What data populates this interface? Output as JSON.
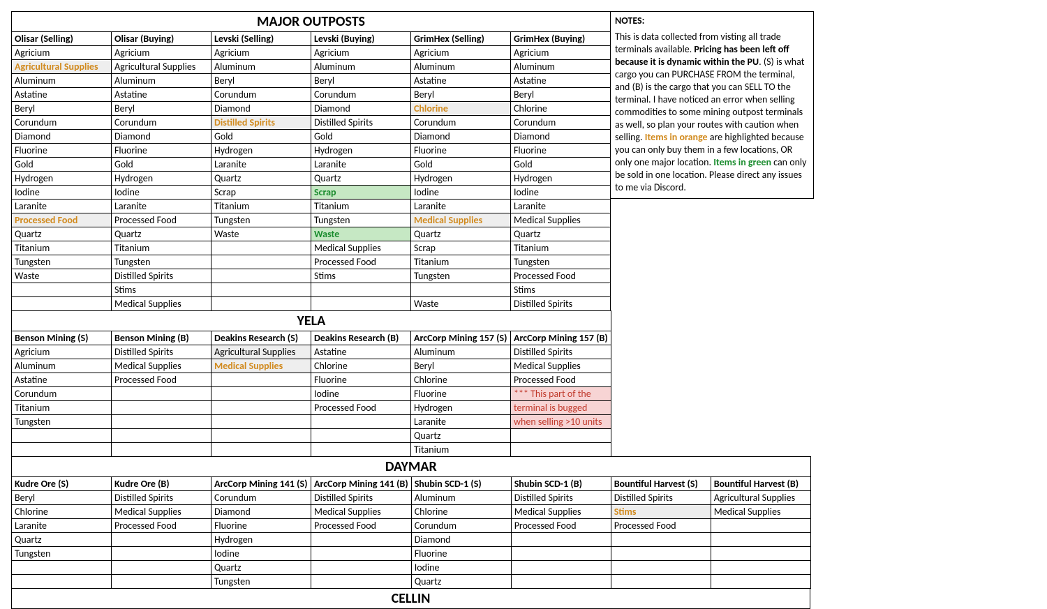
{
  "titles": {
    "major": "MAJOR OUTPOSTS",
    "yela": "YELA",
    "daymar": "DAYMAR",
    "cellin": "CELLIN"
  },
  "notes": {
    "heading": "NOTES:",
    "t0": "This is data collected from visting all trade terminals available.  ",
    "t1": "Pricing has been left off because it is dynamic within the PU",
    "t2": ".  (S) is what cargo you can PURCHASE FROM the terminal, and (B) is the cargo that you can SELL TO the terminal.  I have noticed an error when selling commodities to some mining outpost terminals as well, so plan your routes with caution when selling. ",
    "t3": "Items in orange",
    "t4": " are highlighted because you can only buy them in a few locations, OR only one major location.  ",
    "t5": "Items in green",
    "t6": " can only be sold in one location.  Please direct any issues to me via Discord."
  },
  "major": {
    "headers": [
      "Olisar (Selling)",
      "Olisar (Buying)",
      "Levski (Selling)",
      "Levski (Buying)",
      "GrimHex (Selling)",
      "GrimHex (Buying)"
    ],
    "rows": [
      [
        {
          "v": "Agricium"
        },
        {
          "v": "Agricium"
        },
        {
          "v": "Agricium"
        },
        {
          "v": "Agricium"
        },
        {
          "v": "Agricium"
        },
        {
          "v": "Agricium"
        }
      ],
      [
        {
          "v": "Agricultural Supplies",
          "c": "orange",
          "bg": "grey"
        },
        {
          "v": "Agricultural Supplies"
        },
        {
          "v": "Aluminum"
        },
        {
          "v": "Aluminum"
        },
        {
          "v": "Aluminum"
        },
        {
          "v": "Aluminum"
        }
      ],
      [
        {
          "v": "Aluminum"
        },
        {
          "v": "Aluminum"
        },
        {
          "v": "Beryl"
        },
        {
          "v": "Beryl"
        },
        {
          "v": "Astatine"
        },
        {
          "v": "Astatine"
        }
      ],
      [
        {
          "v": "Astatine"
        },
        {
          "v": "Astatine"
        },
        {
          "v": "Corundum"
        },
        {
          "v": "Corundum"
        },
        {
          "v": "Beryl"
        },
        {
          "v": "Beryl"
        }
      ],
      [
        {
          "v": "Beryl"
        },
        {
          "v": "Beryl"
        },
        {
          "v": "Diamond"
        },
        {
          "v": "Diamond"
        },
        {
          "v": "Chlorine",
          "c": "orange",
          "bg": "grey"
        },
        {
          "v": "Chlorine"
        }
      ],
      [
        {
          "v": "Corundum"
        },
        {
          "v": "Corundum"
        },
        {
          "v": "Distilled Spirits",
          "c": "orange",
          "bg": "grey"
        },
        {
          "v": "Distilled Spirits"
        },
        {
          "v": "Corundum"
        },
        {
          "v": "Corundum"
        }
      ],
      [
        {
          "v": "Diamond"
        },
        {
          "v": "Diamond"
        },
        {
          "v": "Gold"
        },
        {
          "v": "Gold"
        },
        {
          "v": "Diamond"
        },
        {
          "v": "Diamond"
        }
      ],
      [
        {
          "v": "Fluorine"
        },
        {
          "v": "Fluorine"
        },
        {
          "v": "Hydrogen"
        },
        {
          "v": "Hydrogen"
        },
        {
          "v": "Fluorine"
        },
        {
          "v": "Fluorine"
        }
      ],
      [
        {
          "v": "Gold"
        },
        {
          "v": "Gold"
        },
        {
          "v": "Laranite"
        },
        {
          "v": "Laranite"
        },
        {
          "v": "Gold"
        },
        {
          "v": "Gold"
        }
      ],
      [
        {
          "v": "Hydrogen"
        },
        {
          "v": "Hydrogen"
        },
        {
          "v": "Quartz"
        },
        {
          "v": "Quartz"
        },
        {
          "v": "Hydrogen"
        },
        {
          "v": "Hydrogen"
        }
      ],
      [
        {
          "v": "Iodine"
        },
        {
          "v": "Iodine"
        },
        {
          "v": "Scrap"
        },
        {
          "v": "Scrap",
          "c": "green",
          "bg": "green"
        },
        {
          "v": "Iodine"
        },
        {
          "v": "Iodine"
        }
      ],
      [
        {
          "v": "Laranite"
        },
        {
          "v": "Laranite"
        },
        {
          "v": "Titanium"
        },
        {
          "v": "Titanium"
        },
        {
          "v": "Laranite"
        },
        {
          "v": "Laranite"
        }
      ],
      [
        {
          "v": "Processed Food",
          "c": "orange",
          "bg": "grey"
        },
        {
          "v": "Processed Food"
        },
        {
          "v": "Tungsten"
        },
        {
          "v": "Tungsten"
        },
        {
          "v": "Medical Supplies",
          "c": "orange",
          "bg": "grey"
        },
        {
          "v": "Medical Supplies"
        }
      ],
      [
        {
          "v": "Quartz"
        },
        {
          "v": "Quartz"
        },
        {
          "v": "Waste"
        },
        {
          "v": "Waste",
          "c": "green",
          "bg": "green"
        },
        {
          "v": "Quartz"
        },
        {
          "v": "Quartz"
        }
      ],
      [
        {
          "v": "Titanium"
        },
        {
          "v": "Titanium"
        },
        {
          "v": ""
        },
        {
          "v": "Medical Supplies"
        },
        {
          "v": "Scrap"
        },
        {
          "v": "Titanium"
        }
      ],
      [
        {
          "v": "Tungsten"
        },
        {
          "v": "Tungsten"
        },
        {
          "v": ""
        },
        {
          "v": "Processed Food"
        },
        {
          "v": "Titanium"
        },
        {
          "v": "Tungsten"
        }
      ],
      [
        {
          "v": "Waste"
        },
        {
          "v": "Distilled Spirits"
        },
        {
          "v": ""
        },
        {
          "v": "Stims"
        },
        {
          "v": "Tungsten"
        },
        {
          "v": "Processed Food"
        }
      ],
      [
        {
          "v": ""
        },
        {
          "v": "Stims"
        },
        {
          "v": ""
        },
        {
          "v": ""
        },
        {
          "v": ""
        },
        {
          "v": "Stims"
        }
      ],
      [
        {
          "v": ""
        },
        {
          "v": "Medical Supplies"
        },
        {
          "v": ""
        },
        {
          "v": ""
        },
        {
          "v": "Waste"
        },
        {
          "v": "Distilled Spirits"
        }
      ]
    ]
  },
  "yela": {
    "headers": [
      "Benson Mining (S)",
      "Benson Mining (B)",
      "Deakins Research (S)",
      "Deakins Research (B)",
      "ArcCorp Mining 157 (S)",
      "ArcCorp Mining 157 (B)"
    ],
    "rows": [
      [
        {
          "v": "Agricium"
        },
        {
          "v": "Distilled Spirits"
        },
        {
          "v": "Agricultural Supplies",
          "bg": "grey"
        },
        {
          "v": "Astatine"
        },
        {
          "v": "Aluminum"
        },
        {
          "v": "Distilled Spirits"
        }
      ],
      [
        {
          "v": "Aluminum"
        },
        {
          "v": "Medical Supplies"
        },
        {
          "v": "Medical Supplies",
          "c": "orange",
          "bg": "grey"
        },
        {
          "v": "Chlorine"
        },
        {
          "v": "Beryl"
        },
        {
          "v": "Medical Supplies"
        }
      ],
      [
        {
          "v": "Astatine"
        },
        {
          "v": "Processed Food"
        },
        {
          "v": ""
        },
        {
          "v": "Fluorine"
        },
        {
          "v": "Chlorine"
        },
        {
          "v": "Processed Food"
        }
      ],
      [
        {
          "v": "Corundum"
        },
        {
          "v": ""
        },
        {
          "v": ""
        },
        {
          "v": "Iodine"
        },
        {
          "v": "Fluorine"
        },
        {
          "v": "*** This part of the",
          "c": "red",
          "bg": "pink"
        }
      ],
      [
        {
          "v": "Titanium"
        },
        {
          "v": ""
        },
        {
          "v": ""
        },
        {
          "v": "Processed Food"
        },
        {
          "v": "Hydrogen"
        },
        {
          "v": "terminal is bugged",
          "c": "red",
          "bg": "pink"
        }
      ],
      [
        {
          "v": "Tungsten"
        },
        {
          "v": ""
        },
        {
          "v": ""
        },
        {
          "v": ""
        },
        {
          "v": "Laranite"
        },
        {
          "v": "when selling >10 units",
          "c": "red",
          "bg": "pink"
        }
      ],
      [
        {
          "v": ""
        },
        {
          "v": ""
        },
        {
          "v": ""
        },
        {
          "v": ""
        },
        {
          "v": "Quartz"
        },
        {
          "v": ""
        }
      ],
      [
        {
          "v": ""
        },
        {
          "v": ""
        },
        {
          "v": ""
        },
        {
          "v": ""
        },
        {
          "v": "Titanium"
        },
        {
          "v": ""
        }
      ]
    ]
  },
  "daymar": {
    "headers": [
      "Kudre Ore (S)",
      "Kudre Ore (B)",
      "ArcCorp Mining 141 (S)",
      "ArcCorp Mining 141 (B)",
      "Shubin SCD-1 (S)",
      "Shubin SCD-1 (B)",
      "Bountiful Harvest (S)",
      "Bountiful Harvest (B)"
    ],
    "rows": [
      [
        {
          "v": "Beryl"
        },
        {
          "v": "Distilled Spirits"
        },
        {
          "v": "Corundum"
        },
        {
          "v": "Distilled Spirits"
        },
        {
          "v": "Aluminum"
        },
        {
          "v": "Distilled Spirits"
        },
        {
          "v": "Distilled Spirits"
        },
        {
          "v": "Agricultural Supplies"
        }
      ],
      [
        {
          "v": "Chlorine"
        },
        {
          "v": "Medical Supplies"
        },
        {
          "v": "Diamond"
        },
        {
          "v": "Medical Supplies"
        },
        {
          "v": "Chlorine"
        },
        {
          "v": "Medical Supplies"
        },
        {
          "v": "Stims",
          "c": "orange",
          "bg": "grey"
        },
        {
          "v": "Medical Supplies"
        }
      ],
      [
        {
          "v": "Laranite"
        },
        {
          "v": "Processed Food"
        },
        {
          "v": "Fluorine"
        },
        {
          "v": "Processed Food"
        },
        {
          "v": "Corundum"
        },
        {
          "v": "Processed Food"
        },
        {
          "v": "Processed Food"
        },
        {
          "v": ""
        }
      ],
      [
        {
          "v": "Quartz"
        },
        {
          "v": ""
        },
        {
          "v": "Hydrogen"
        },
        {
          "v": ""
        },
        {
          "v": "Diamond"
        },
        {
          "v": ""
        },
        {
          "v": ""
        },
        {
          "v": ""
        }
      ],
      [
        {
          "v": "Tungsten"
        },
        {
          "v": ""
        },
        {
          "v": "Iodine"
        },
        {
          "v": ""
        },
        {
          "v": "Fluorine"
        },
        {
          "v": ""
        },
        {
          "v": ""
        },
        {
          "v": ""
        }
      ],
      [
        {
          "v": ""
        },
        {
          "v": ""
        },
        {
          "v": "Quartz"
        },
        {
          "v": ""
        },
        {
          "v": "Iodine"
        },
        {
          "v": ""
        },
        {
          "v": ""
        },
        {
          "v": ""
        }
      ],
      [
        {
          "v": ""
        },
        {
          "v": ""
        },
        {
          "v": "Tungsten"
        },
        {
          "v": ""
        },
        {
          "v": "Quartz"
        },
        {
          "v": ""
        },
        {
          "v": ""
        },
        {
          "v": ""
        }
      ]
    ]
  },
  "colw": {
    "six": 143,
    "eight": 143,
    "notes": 290
  }
}
